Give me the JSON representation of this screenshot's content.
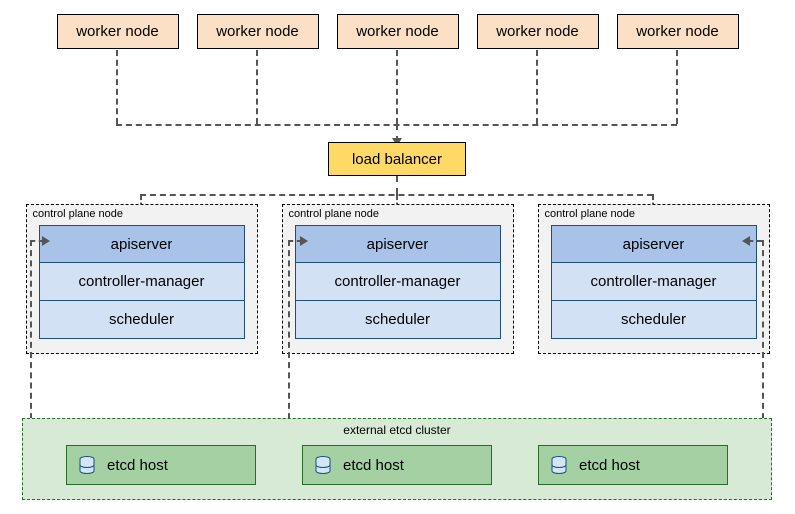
{
  "workers": [
    {
      "label": "worker node"
    },
    {
      "label": "worker node"
    },
    {
      "label": "worker node"
    },
    {
      "label": "worker node"
    },
    {
      "label": "worker node"
    }
  ],
  "load_balancer": {
    "label": "load balancer"
  },
  "control_planes": [
    {
      "title": "control plane node",
      "apiserver": "apiserver",
      "controller_manager": "controller-manager",
      "scheduler": "scheduler"
    },
    {
      "title": "control plane node",
      "apiserver": "apiserver",
      "controller_manager": "controller-manager",
      "scheduler": "scheduler"
    },
    {
      "title": "control plane node",
      "apiserver": "apiserver",
      "controller_manager": "controller-manager",
      "scheduler": "scheduler"
    }
  ],
  "etcd_cluster": {
    "title": "external etcd cluster",
    "hosts": [
      {
        "label": "etcd host"
      },
      {
        "label": "etcd host"
      },
      {
        "label": "etcd host"
      }
    ]
  },
  "colors": {
    "worker_bg": "#fbe0c5",
    "lb_bg": "#ffd966",
    "cp_bg": "#f2f2f2",
    "api_bg": "#a9c3e8",
    "component_bg": "#d2e2f4",
    "etcd_cluster_bg": "#d6ead6",
    "etcd_host_bg": "#a4d0a4"
  }
}
